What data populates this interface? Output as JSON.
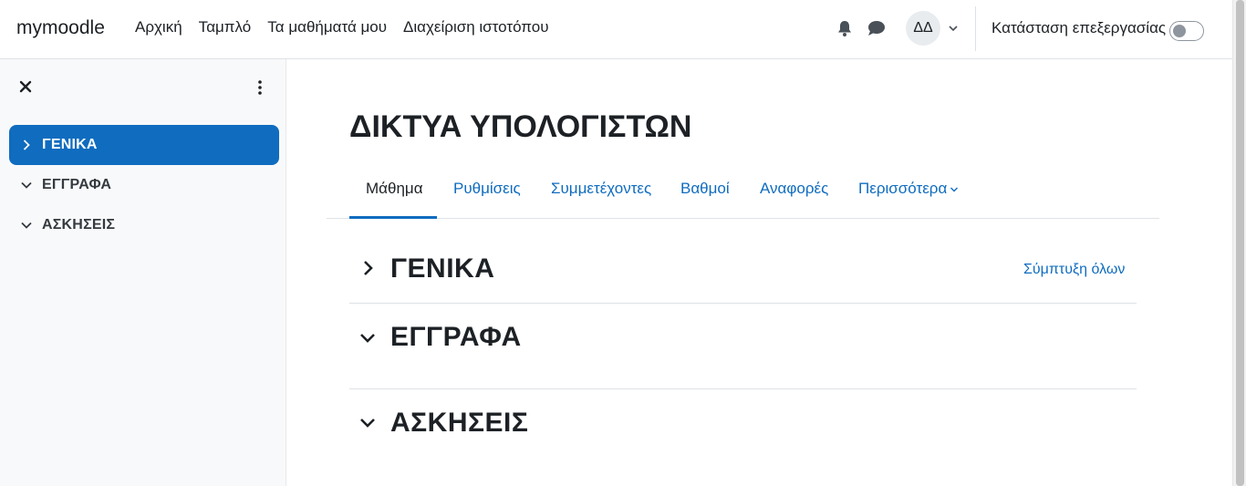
{
  "navbar": {
    "brand": "mymoodle",
    "links": [
      "Αρχική",
      "Ταμπλό",
      "Τα μαθήματά μου",
      "Διαχείριση ιστοτόπου"
    ],
    "avatar_initials": "ΔΔ",
    "edit_mode_label": "Κατάσταση επεξεργασίας",
    "edit_mode_on": false
  },
  "sidebar": {
    "items": [
      {
        "label": "ΓΕΝΙΚΑ",
        "active": true,
        "expanded": false
      },
      {
        "label": "ΕΓΓΡΑΦΑ",
        "active": false,
        "expanded": true
      },
      {
        "label": "ΑΣΚΗΣΕΙΣ",
        "active": false,
        "expanded": true
      }
    ]
  },
  "main": {
    "course_title": "ΔΙΚΤΥΑ ΥΠΟΛΟΓΙΣΤΩΝ",
    "tabs": [
      "Μάθημα",
      "Ρυθμίσεις",
      "Συμμετέχοντες",
      "Βαθμοί",
      "Αναφορές",
      "Περισσότερα"
    ],
    "active_tab": "Μάθημα",
    "collapse_all_label": "Σύμπτυξη όλων",
    "sections": [
      {
        "title": "ΓΕΝΙΚΑ",
        "expanded": false
      },
      {
        "title": "ΕΓΓΡΑΦΑ",
        "expanded": true
      },
      {
        "title": "ΑΣΚΗΣΕΙΣ",
        "expanded": true
      }
    ]
  },
  "colors": {
    "primary": "#0f6cbf",
    "text": "#1d2125",
    "sidebar_bg": "#f8f9fa"
  }
}
